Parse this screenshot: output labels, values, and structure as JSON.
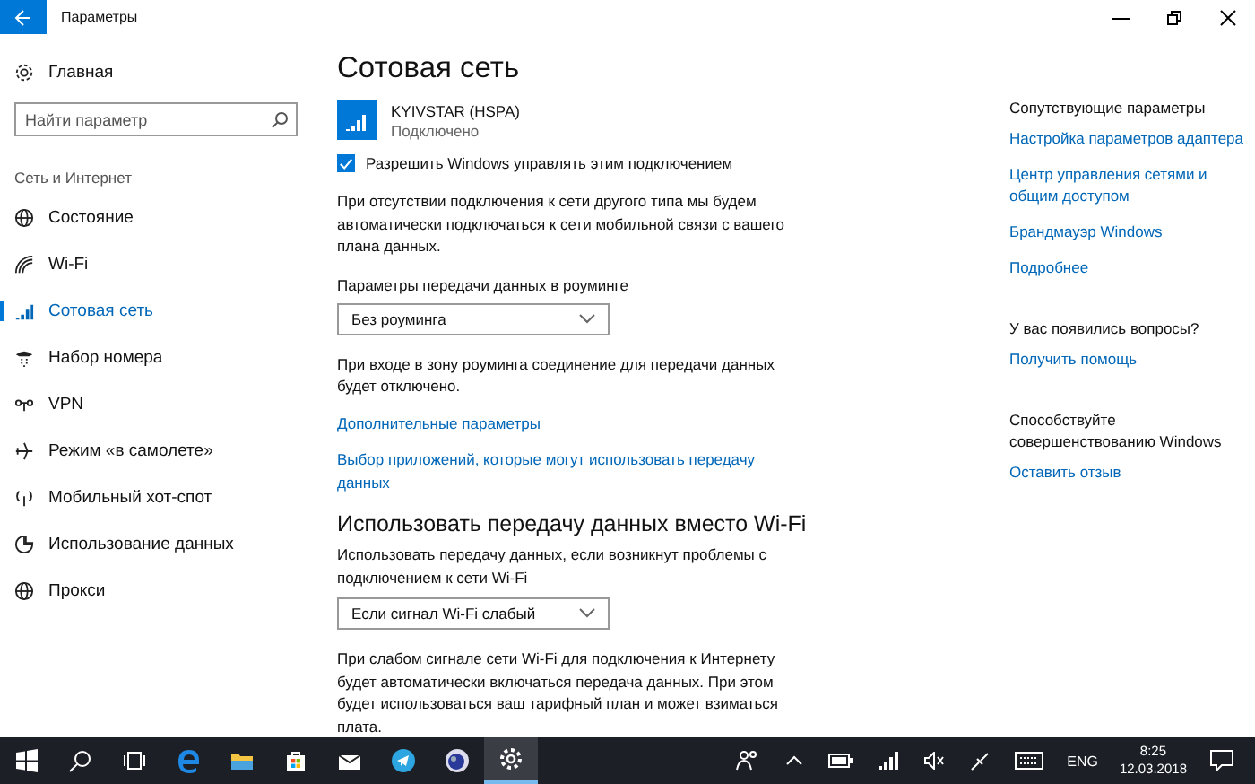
{
  "window": {
    "title": "Параметры"
  },
  "sidebar": {
    "home": "Главная",
    "search": {
      "placeholder": "Найти параметр"
    },
    "section": "Сеть и Интернет",
    "items": [
      {
        "label": "Состояние",
        "selected": false
      },
      {
        "label": "Wi-Fi",
        "selected": false
      },
      {
        "label": "Сотовая сеть",
        "selected": true
      },
      {
        "label": "Набор номера",
        "selected": false
      },
      {
        "label": "VPN",
        "selected": false
      },
      {
        "label": "Режим «в самолете»",
        "selected": false
      },
      {
        "label": "Мобильный хот-спот",
        "selected": false
      },
      {
        "label": "Использование данных",
        "selected": false
      },
      {
        "label": "Прокси",
        "selected": false
      }
    ]
  },
  "content": {
    "title": "Сотовая сеть",
    "network": {
      "name": "KYIVSTAR (HSPA)",
      "status": "Подключено"
    },
    "allow_checkbox": {
      "label": "Разрешить Windows управлять этим подключением",
      "checked": true
    },
    "allow_description": "При отсутствии подключения к сети другого типа мы будем автоматически подключаться к сети мобильной связи с вашего плана данных.",
    "roaming": {
      "label": "Параметры передачи данных в роуминге",
      "value": "Без роуминга",
      "description": "При входе в зону роуминга соединение для передачи данных будет отключено."
    },
    "links": [
      "Дополнительные параметры",
      "Выбор приложений, которые могут использовать передачу данных"
    ],
    "wifi_section": {
      "title": "Использовать передачу данных вместо Wi-Fi",
      "label": "Использовать передачу данных, если возникнут проблемы с подключением к сети Wi-Fi",
      "value": "Если сигнал Wi-Fi слабый",
      "description": "При слабом сигнале сети Wi-Fi для подключения к Интернету будет автоматически включаться передача данных. При этом будет использоваться ваш тарифный план и может взиматься плата."
    }
  },
  "related": {
    "title": "Сопутствующие параметры",
    "links": [
      "Настройка параметров адаптера",
      "Центр управления сетями и общим доступом",
      "Брандмауэр Windows",
      "Подробнее"
    ]
  },
  "questions": {
    "title": "У вас появились вопросы?",
    "link": "Получить помощь"
  },
  "feedback": {
    "title": "Способствуйте совершенствованию Windows",
    "link": "Оставить отзыв"
  },
  "taskbar": {
    "apps": [
      {
        "selected": false
      },
      {
        "selected": false
      },
      {
        "selected": false
      },
      {
        "selected": false
      },
      {
        "selected": false
      },
      {
        "selected": false
      },
      {
        "selected": false
      },
      {
        "selected": false
      },
      {
        "selected": false
      },
      {
        "selected": true
      }
    ],
    "language": "ENG",
    "time": "8:25",
    "date": "12.03.2018"
  }
}
